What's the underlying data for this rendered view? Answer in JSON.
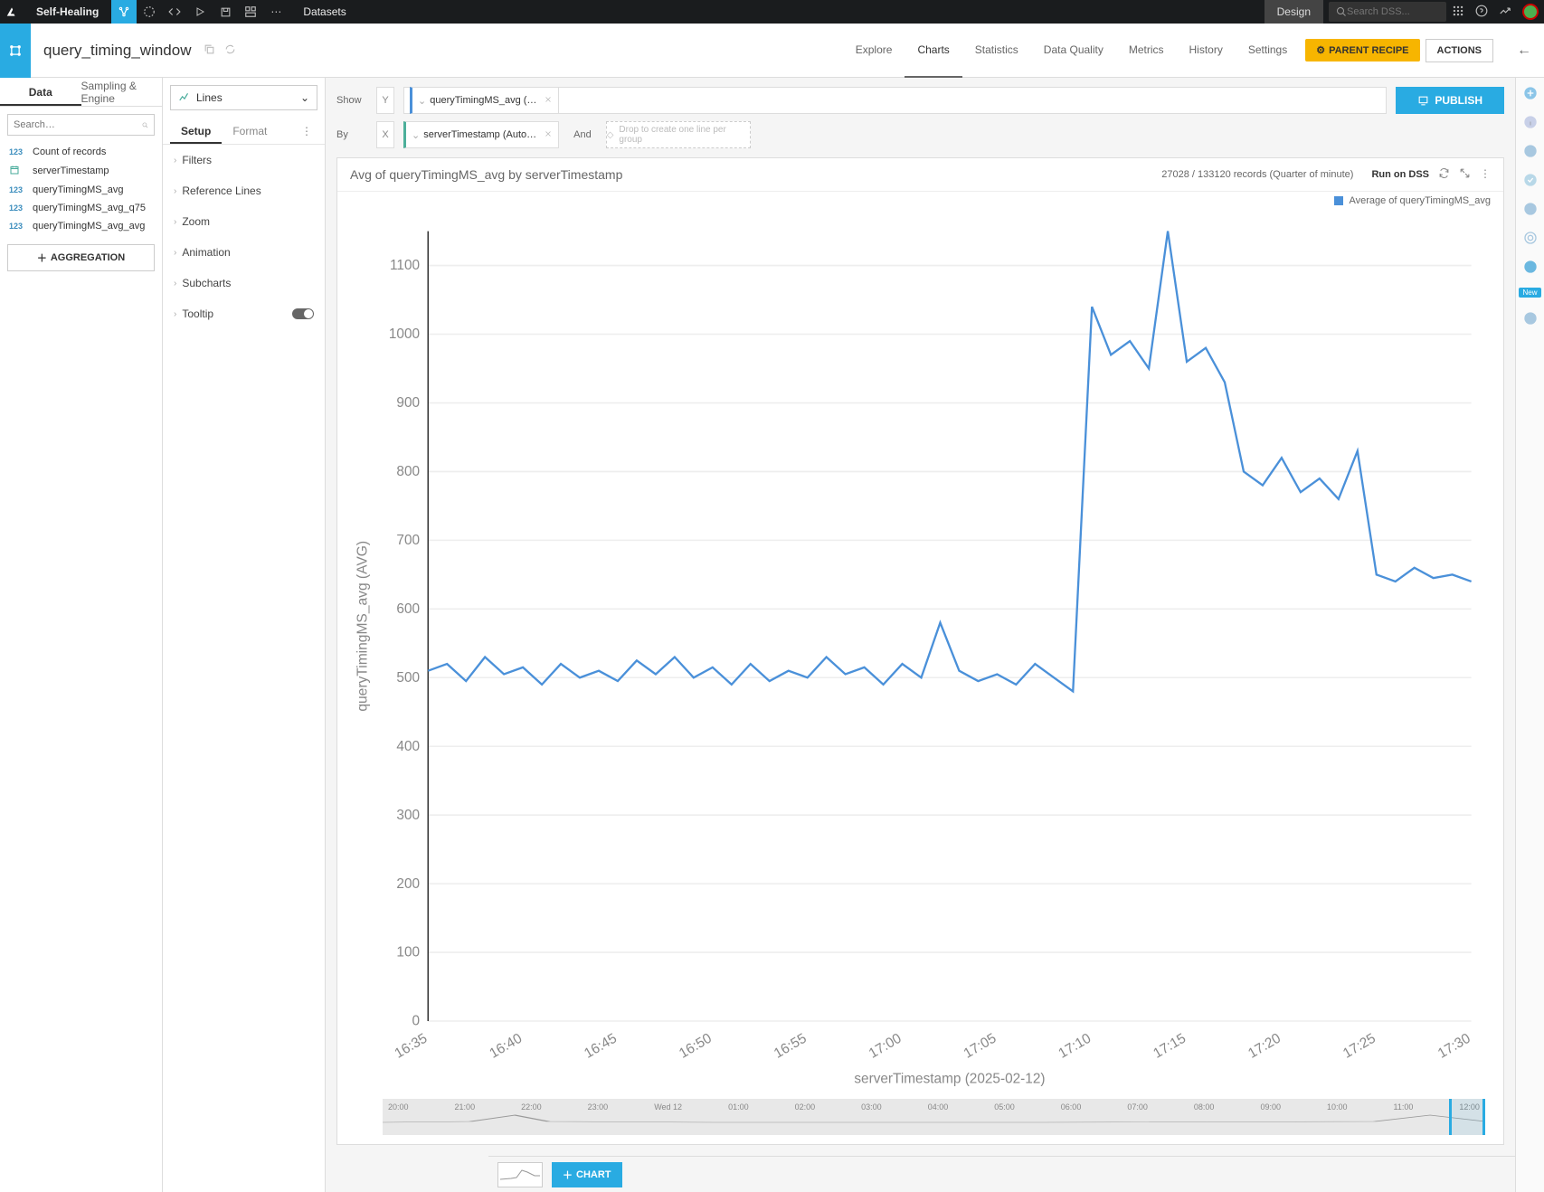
{
  "topbar": {
    "project": "Self-Healing",
    "context": "Datasets",
    "design": "Design",
    "search_placeholder": "Search DSS..."
  },
  "subheader": {
    "dataset_name": "query_timing_window",
    "tabs": [
      "Explore",
      "Charts",
      "Statistics",
      "Data Quality",
      "Metrics",
      "History",
      "Settings"
    ],
    "active_tab": "Charts",
    "parent_recipe": "PARENT RECIPE",
    "actions": "ACTIONS"
  },
  "left": {
    "tabs": [
      "Data",
      "Sampling & Engine"
    ],
    "active_tab": "Data",
    "search_placeholder": "Search…",
    "columns": [
      {
        "type": "123",
        "name": "Count of records"
      },
      {
        "type": "date",
        "name": "serverTimestamp"
      },
      {
        "type": "123",
        "name": "queryTimingMS_avg"
      },
      {
        "type": "123",
        "name": "queryTimingMS_avg_q75"
      },
      {
        "type": "123",
        "name": "queryTimingMS_avg_avg"
      }
    ],
    "aggregation": "AGGREGATION"
  },
  "setup": {
    "chart_type": "Lines",
    "tabs": [
      "Setup",
      "Format"
    ],
    "active_tab": "Setup",
    "sections": [
      "Filters",
      "Reference Lines",
      "Zoom",
      "Animation",
      "Subcharts",
      "Tooltip"
    ]
  },
  "shelves": {
    "show": "Show",
    "by": "By",
    "and": "And",
    "y": "Y",
    "x": "X",
    "y_pill": "queryTimingMS_avg (…",
    "x_pill": "serverTimestamp (Auto…",
    "drop_hint": "Drop to create one line per group",
    "publish": "PUBLISH"
  },
  "chart": {
    "title": "Avg of queryTimingMS_avg by serverTimestamp",
    "records": "27028 / 133120 records (Quarter of minute)",
    "run_on": "Run on DSS",
    "legend": "Average of queryTimingMS_avg",
    "ylabel": "queryTimingMS_avg (AVG)",
    "xlabel": "serverTimestamp (2025-02-12)"
  },
  "timeline": {
    "labels": [
      "20:00",
      "21:00",
      "22:00",
      "23:00",
      "Wed 12",
      "01:00",
      "02:00",
      "03:00",
      "04:00",
      "05:00",
      "06:00",
      "07:00",
      "08:00",
      "09:00",
      "10:00",
      "11:00",
      "12:00"
    ]
  },
  "bottom": {
    "add_chart": "CHART"
  },
  "rail": {
    "new_badge": "New"
  },
  "chart_data": {
    "type": "line",
    "xlabel": "serverTimestamp (2025-02-12)",
    "ylabel": "queryTimingMS_avg (AVG)",
    "ylim": [
      0,
      1150
    ],
    "x_ticks": [
      "16:35",
      "16:40",
      "16:45",
      "16:50",
      "16:55",
      "17:00",
      "17:05",
      "17:10",
      "17:15",
      "17:20",
      "17:25",
      "17:30"
    ],
    "y_ticks": [
      0,
      100,
      200,
      300,
      400,
      500,
      600,
      700,
      800,
      900,
      1000,
      1100
    ],
    "series": [
      {
        "name": "Average of queryTimingMS_avg",
        "color": "#4a90d9",
        "x": [
          "16:35",
          "16:36",
          "16:37",
          "16:38",
          "16:39",
          "16:40",
          "16:41",
          "16:42",
          "16:43",
          "16:44",
          "16:45",
          "16:46",
          "16:47",
          "16:48",
          "16:49",
          "16:50",
          "16:51",
          "16:52",
          "16:53",
          "16:54",
          "16:55",
          "16:56",
          "16:57",
          "16:58",
          "16:59",
          "17:00",
          "17:01",
          "17:02",
          "17:03",
          "17:04",
          "17:05",
          "17:06",
          "17:07",
          "17:08",
          "17:09",
          "17:10",
          "17:11",
          "17:12",
          "17:13",
          "17:14",
          "17:15",
          "17:16",
          "17:17",
          "17:18",
          "17:19",
          "17:20",
          "17:21",
          "17:22",
          "17:23",
          "17:24",
          "17:25",
          "17:26",
          "17:27",
          "17:28",
          "17:29",
          "17:30"
        ],
        "values": [
          510,
          520,
          495,
          530,
          505,
          515,
          490,
          520,
          500,
          510,
          495,
          525,
          505,
          530,
          500,
          515,
          490,
          520,
          495,
          510,
          500,
          530,
          505,
          515,
          490,
          520,
          500,
          580,
          510,
          495,
          505,
          490,
          520,
          500,
          480,
          1040,
          970,
          990,
          950,
          1150,
          960,
          980,
          930,
          800,
          780,
          820,
          770,
          790,
          760,
          830,
          650,
          640,
          660,
          645,
          650,
          640
        ]
      }
    ]
  }
}
